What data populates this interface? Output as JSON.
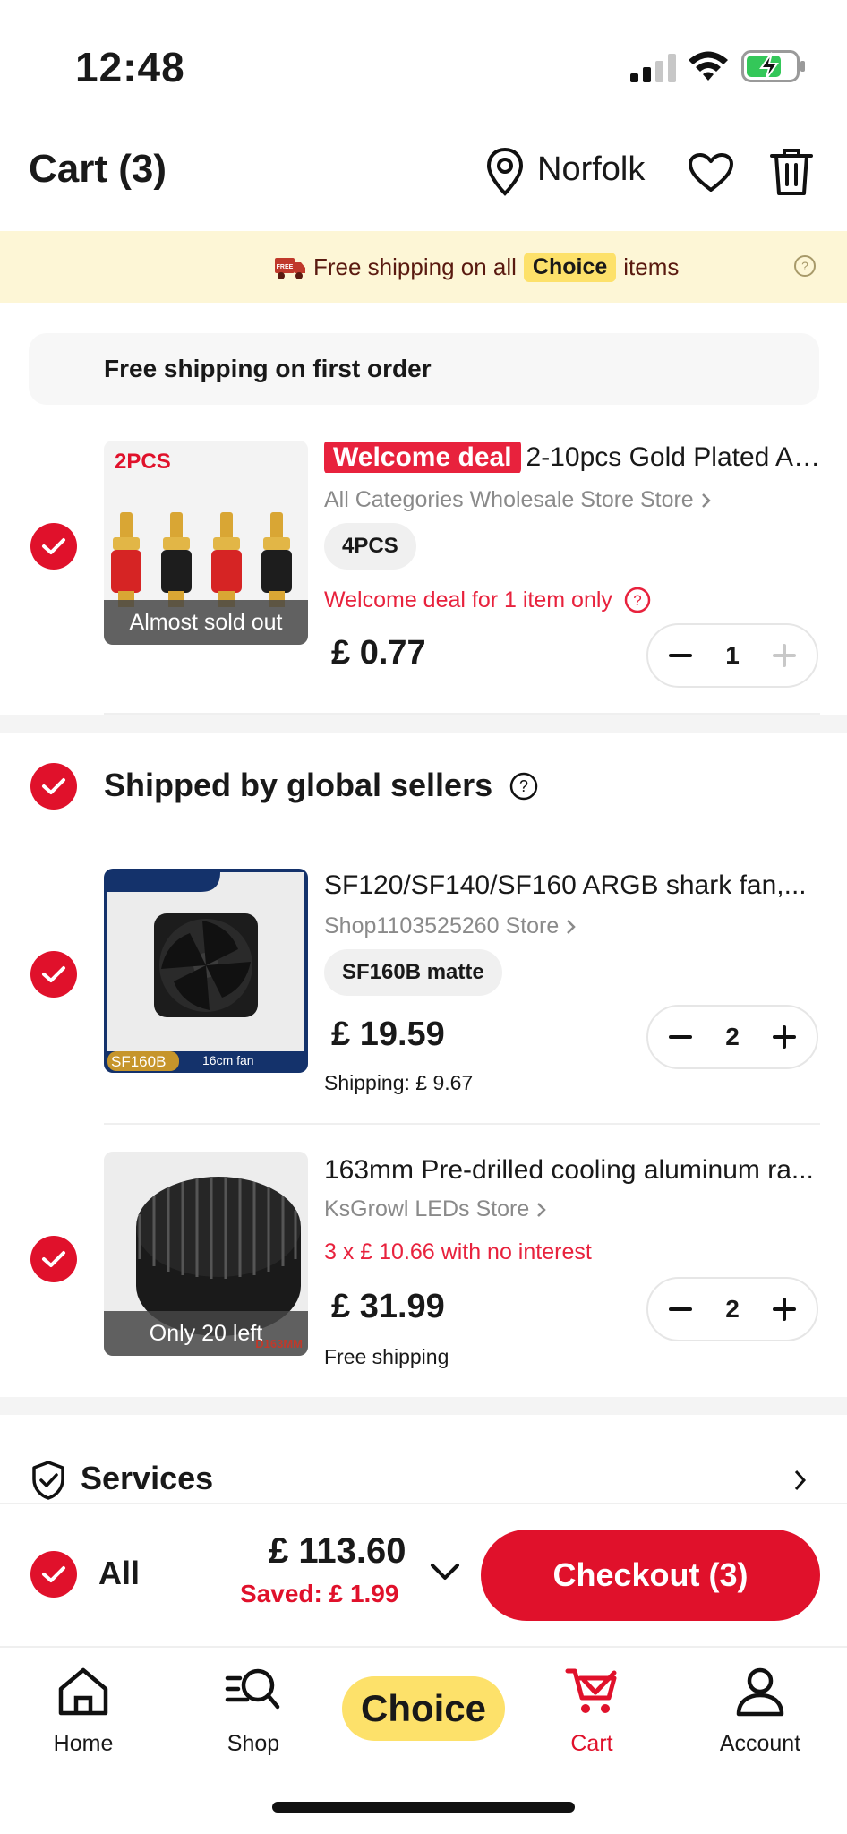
{
  "status_bar": {
    "time": "12:48"
  },
  "header": {
    "title": "Cart (3)",
    "location": "Norfolk"
  },
  "banner": {
    "prefix": "Free shipping on all",
    "chip": "Choice",
    "suffix": "items",
    "free_tag": "FREE"
  },
  "first_order": {
    "text": "Free shipping on first order"
  },
  "item1": {
    "badge": "Welcome deal",
    "title": "2-10pcs Gold Plated Am...",
    "store": "All Categories Wholesale Store Store",
    "variant": "4PCS",
    "promo": "Welcome deal for 1 item only",
    "price": "£ 0.77",
    "qty": "1",
    "overlay": "Almost sold out",
    "thumb_tag": "2PCS"
  },
  "section": {
    "title": "Shipped by global sellers"
  },
  "item2": {
    "title": "SF120/SF140/SF160 ARGB shark fan,...",
    "store": "Shop1103525260 Store",
    "variant": "SF160B matte",
    "price": "£ 19.59",
    "shipping": "Shipping: £ 9.67",
    "qty": "2",
    "thumb_tag": "SF160B",
    "thumb_caption": "16cm fan"
  },
  "item3": {
    "title": "163mm Pre-drilled cooling aluminum ra...",
    "store": "KsGrowl LEDs Store",
    "promo": "3 x  £ 10.66 with no interest",
    "price": "£ 31.99",
    "shipping": "Free shipping",
    "qty": "2",
    "overlay": "Only 20 left",
    "thumb_tag": "D163MM"
  },
  "services": {
    "title": "Services"
  },
  "checkout": {
    "all_label": "All",
    "total": "£ 113.60",
    "saved": "Saved:  £ 1.99",
    "button": "Checkout  (3)"
  },
  "nav": {
    "home": "Home",
    "shop": "Shop",
    "choice": "Choice",
    "cart": "Cart",
    "account": "Account"
  },
  "colors": {
    "accent": "#e0112b",
    "choice_yellow": "#fde16a",
    "banner_bg": "#fdf6d6"
  }
}
